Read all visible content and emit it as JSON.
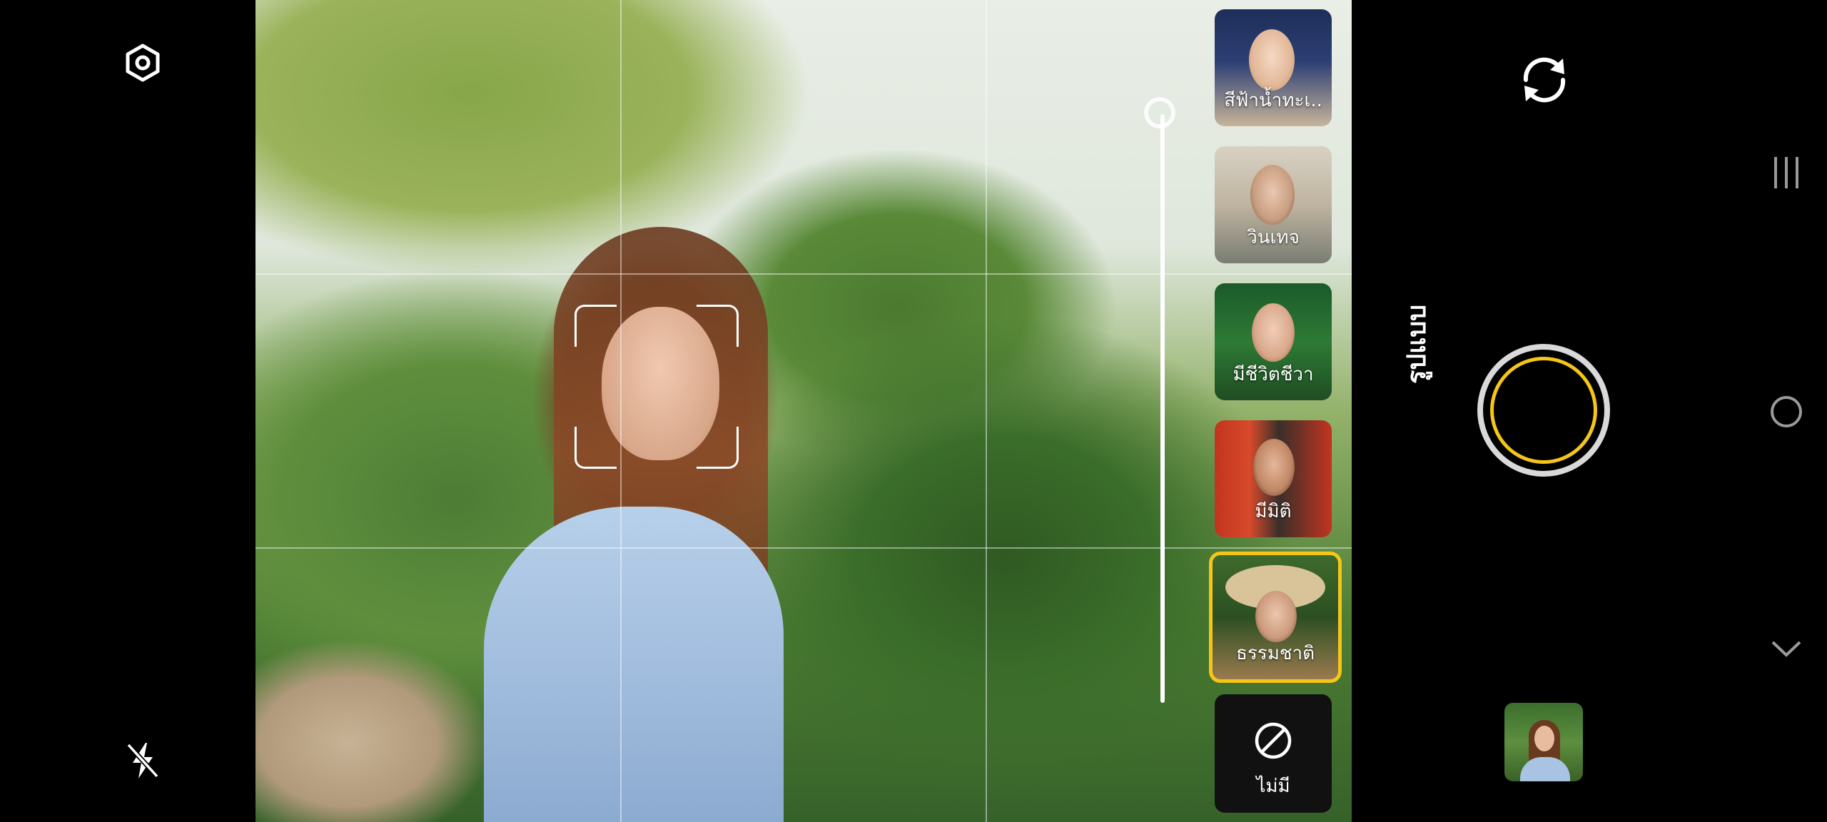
{
  "mode_label": "รูปแบบ",
  "filters": [
    {
      "label": "สีฟ้าน้ำทะเ..",
      "selected": false
    },
    {
      "label": "วินเทจ",
      "selected": false
    },
    {
      "label": "มีชีวิตชีวา",
      "selected": false
    },
    {
      "label": "มีมิติ",
      "selected": false
    },
    {
      "label": "ธรรมชาติ",
      "selected": true
    }
  ],
  "none_option": {
    "label": "ไม่มี"
  },
  "icons": {
    "settings": "hexagon-gear-icon",
    "flash": "flash-off-icon",
    "switch_camera": "rotate-camera-icon",
    "none": "prohibit-icon",
    "nav_recents": "recents-icon",
    "nav_home": "home-icon",
    "nav_back": "chevron-down-icon"
  },
  "colors": {
    "accent": "#f5c518",
    "background": "#000000",
    "shutter_ring": "#d9d9d9"
  }
}
